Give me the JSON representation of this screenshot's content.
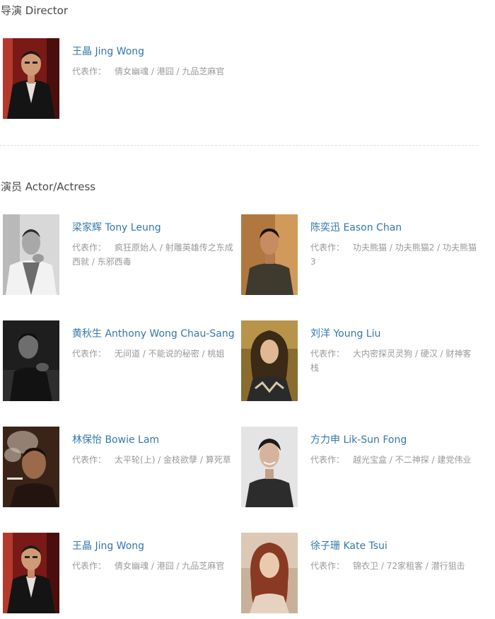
{
  "director_section": {
    "title": "导演 Director"
  },
  "actor_section": {
    "title": "演员 Actor/Actress"
  },
  "works_label": "代表作：",
  "director": {
    "name": "王晶 Jing Wong",
    "works": "倩女幽魂 / 港囧 / 九品芝麻官",
    "photo_tone": "red-carpet"
  },
  "actors": [
    {
      "name": "梁家辉 Tony Leung",
      "works": "疯狂原始人 / 射雕英雄传之东成西就 / 东邪西毒",
      "photo_tone": "mono-light"
    },
    {
      "name": "陈奕迅 Eason Chan",
      "works": "功夫熊猫 / 功夫熊猫2 / 功夫熊猫3",
      "photo_tone": "warm-brown"
    },
    {
      "name": "黄秋生 Anthony Wong Chau-Sang",
      "works": "无间道 / 不能说的秘密 / 桃姐",
      "photo_tone": "mono-dark"
    },
    {
      "name": "刘洋 Young Liu",
      "works": "大内密探灵灵狗 / 硬汉 / 财神客栈",
      "photo_tone": "gold"
    },
    {
      "name": "林保怡 Bowie Lam",
      "works": "太平轮(上) / 金枝欲孽 / 算死草",
      "photo_tone": "smoke"
    },
    {
      "name": "方力申 Lik-Sun Fong",
      "works": "越光宝盒 / 不二神探 / 建党伟业",
      "photo_tone": "grey-light"
    },
    {
      "name": "王晶 Jing Wong",
      "works": "倩女幽魂 / 港囧 / 九品芝麻官",
      "photo_tone": "red-carpet"
    },
    {
      "name": "徐子珊 Kate Tsui",
      "works": "锦衣卫 / 72家租客 / 潜行狙击",
      "photo_tone": "soft-warm"
    }
  ]
}
